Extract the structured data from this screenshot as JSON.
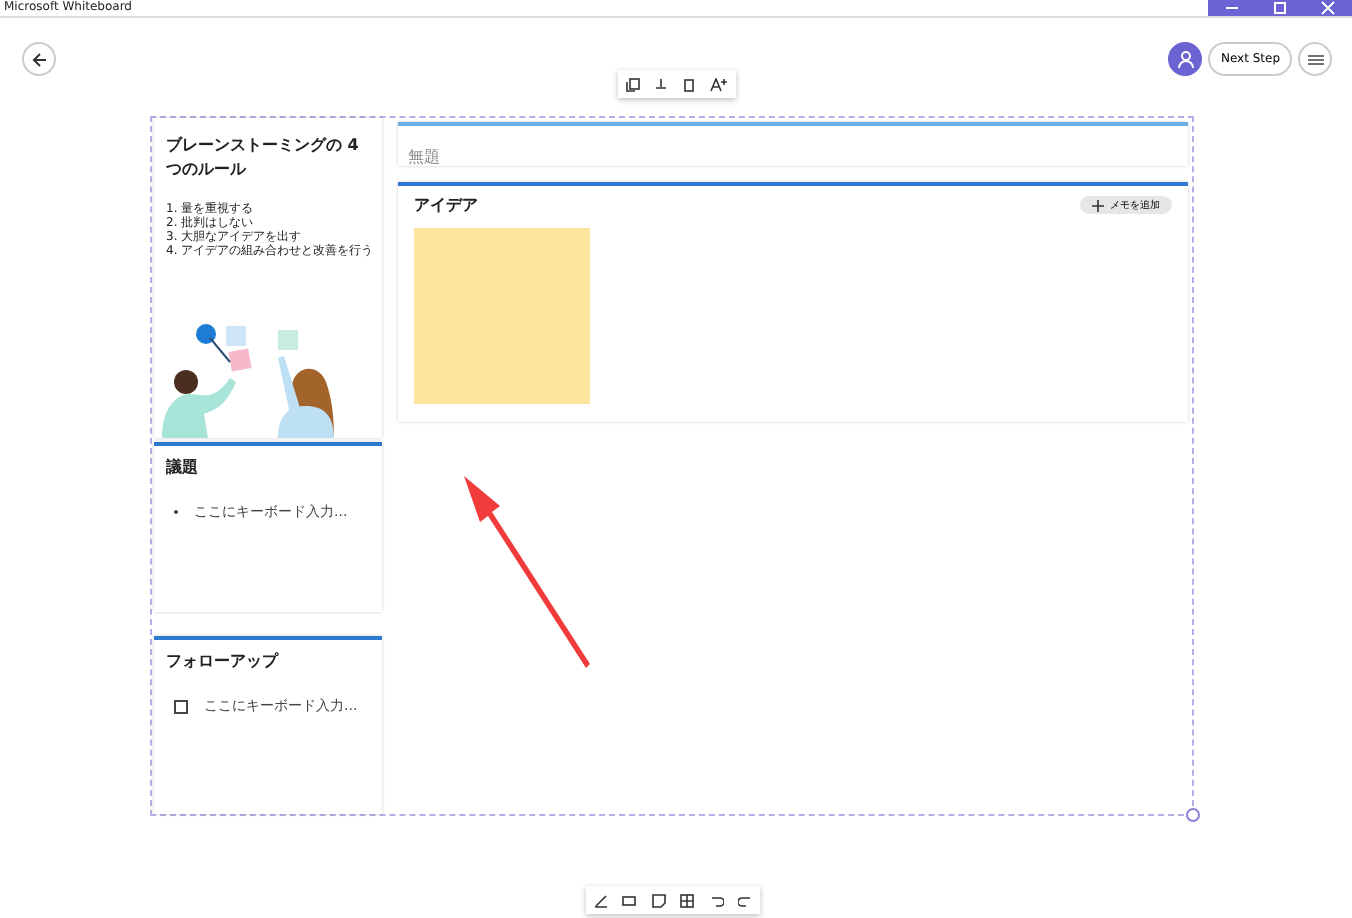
{
  "window": {
    "title": "Microsoft Whiteboard"
  },
  "header": {
    "share_button": "Next Step"
  },
  "rules_card": {
    "title": "ブレーンストーミングの 4 つのルール",
    "items": [
      "1. 量を重視する",
      "2. 批判はしない",
      "3. 大胆なアイデアを出す",
      "4. アイデアの組み合わせと改善を行う"
    ]
  },
  "agenda_card": {
    "title": "議題",
    "items": [
      {
        "kind": "bullet",
        "placeholder": "ここにキーボード入力..."
      }
    ]
  },
  "followup_card": {
    "title": "フォローアップ",
    "items": [
      {
        "kind": "checkbox",
        "checked": false,
        "placeholder": "ここにキーボード入力..."
      }
    ]
  },
  "title_card": {
    "placeholder": "無題"
  },
  "ideas_card": {
    "title": "アイデア",
    "add_button": "メモを追加",
    "notes": [
      {
        "color": "#fde59f"
      }
    ]
  }
}
